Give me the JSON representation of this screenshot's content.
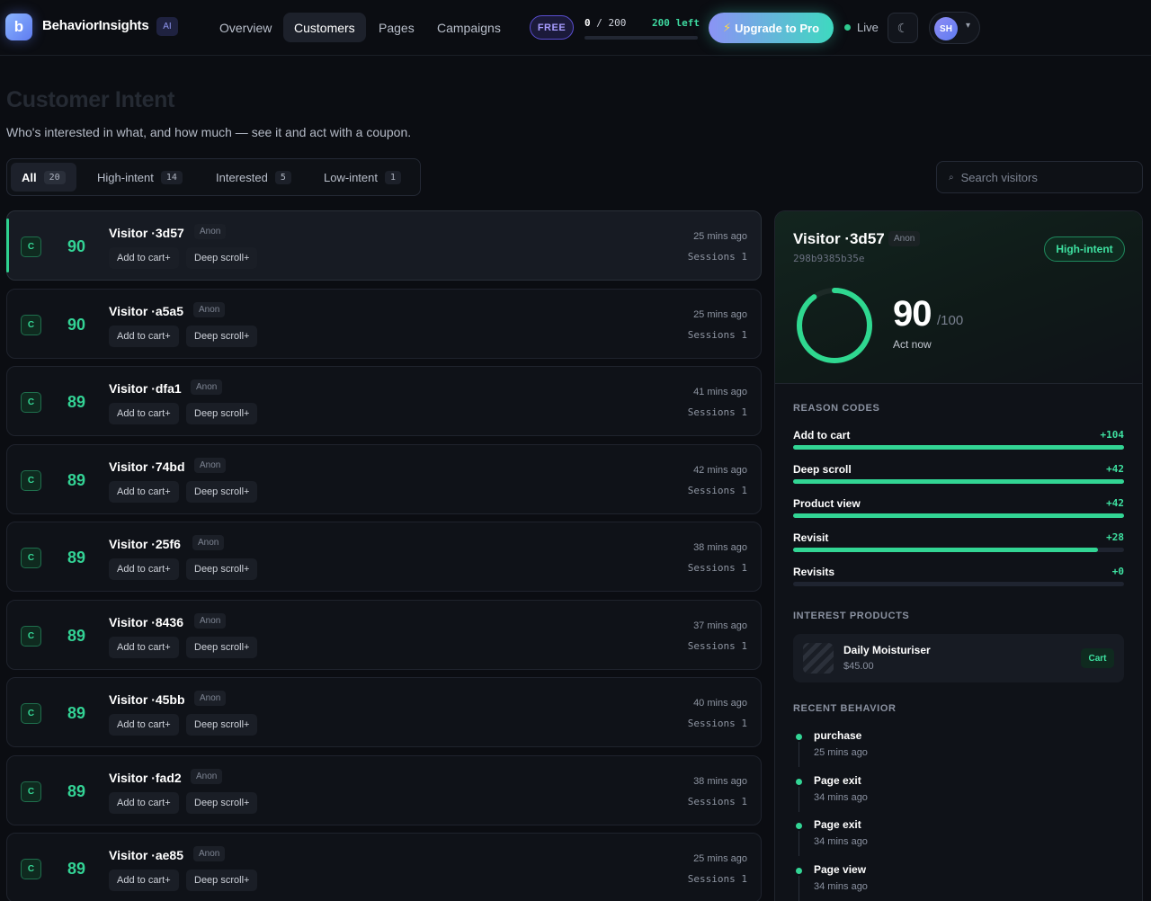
{
  "app": {
    "logo_letter": "b",
    "name": "BehaviorInsights",
    "ai_badge": "AI"
  },
  "nav": [
    {
      "label": "Overview",
      "active": false
    },
    {
      "label": "Customers",
      "active": true
    },
    {
      "label": "Pages",
      "active": false
    },
    {
      "label": "Campaigns",
      "active": false
    }
  ],
  "plan": {
    "badge": "FREE",
    "used": "0",
    "total": "/ 200",
    "left": "200 left",
    "used_fraction": 0
  },
  "upgrade": {
    "icon": "⚡",
    "label": "Upgrade to Pro"
  },
  "status": {
    "live": "Live"
  },
  "theme": {
    "icon": "☾"
  },
  "account": {
    "initials": "SH",
    "caret": "▾"
  },
  "page": {
    "title": "Customer Intent",
    "subtitle": "Who's interested in what, and how much — see it and act with a coupon."
  },
  "filters": [
    {
      "label": "All",
      "count": "20",
      "active": true
    },
    {
      "label": "High-intent",
      "count": "14",
      "active": false
    },
    {
      "label": "Interested",
      "count": "5",
      "active": false
    },
    {
      "label": "Low-intent",
      "count": "1",
      "active": false
    }
  ],
  "search": {
    "placeholder": "Search visitors",
    "icon": "⌕"
  },
  "visitors": [
    {
      "grade": "C",
      "score": "90",
      "name": "Visitor ·3d57",
      "anon": "Anon",
      "tags": [
        "Add to cart+",
        "Deep scroll+"
      ],
      "time": "25 mins ago",
      "sessions": "Sessions 1",
      "selected": true
    },
    {
      "grade": "C",
      "score": "90",
      "name": "Visitor ·a5a5",
      "anon": "Anon",
      "tags": [
        "Add to cart+",
        "Deep scroll+"
      ],
      "time": "25 mins ago",
      "sessions": "Sessions 1",
      "selected": false
    },
    {
      "grade": "C",
      "score": "89",
      "name": "Visitor ·dfa1",
      "anon": "Anon",
      "tags": [
        "Add to cart+",
        "Deep scroll+"
      ],
      "time": "41 mins ago",
      "sessions": "Sessions 1",
      "selected": false
    },
    {
      "grade": "C",
      "score": "89",
      "name": "Visitor ·74bd",
      "anon": "Anon",
      "tags": [
        "Add to cart+",
        "Deep scroll+"
      ],
      "time": "42 mins ago",
      "sessions": "Sessions 1",
      "selected": false
    },
    {
      "grade": "C",
      "score": "89",
      "name": "Visitor ·25f6",
      "anon": "Anon",
      "tags": [
        "Add to cart+",
        "Deep scroll+"
      ],
      "time": "38 mins ago",
      "sessions": "Sessions 1",
      "selected": false
    },
    {
      "grade": "C",
      "score": "89",
      "name": "Visitor ·8436",
      "anon": "Anon",
      "tags": [
        "Add to cart+",
        "Deep scroll+"
      ],
      "time": "37 mins ago",
      "sessions": "Sessions 1",
      "selected": false
    },
    {
      "grade": "C",
      "score": "89",
      "name": "Visitor ·45bb",
      "anon": "Anon",
      "tags": [
        "Add to cart+",
        "Deep scroll+"
      ],
      "time": "40 mins ago",
      "sessions": "Sessions 1",
      "selected": false
    },
    {
      "grade": "C",
      "score": "89",
      "name": "Visitor ·fad2",
      "anon": "Anon",
      "tags": [
        "Add to cart+",
        "Deep scroll+"
      ],
      "time": "38 mins ago",
      "sessions": "Sessions 1",
      "selected": false
    },
    {
      "grade": "C",
      "score": "89",
      "name": "Visitor ·ae85",
      "anon": "Anon",
      "tags": [
        "Add to cart+",
        "Deep scroll+"
      ],
      "time": "25 mins ago",
      "sessions": "Sessions 1",
      "selected": false
    }
  ],
  "detail": {
    "name": "Visitor ·3d57",
    "anon": "Anon",
    "id": "298b9385b35e",
    "intent": "High-intent",
    "score": "90",
    "score_max": "/100",
    "score_fraction": 0.9,
    "note": "Act now",
    "reason_title": "REASON CODES",
    "reasons": [
      {
        "name": "Add to cart",
        "value": "+104",
        "fill": 1.0
      },
      {
        "name": "Deep scroll",
        "value": "+42",
        "fill": 1.0
      },
      {
        "name": "Product view",
        "value": "+42",
        "fill": 1.0
      },
      {
        "name": "Revisit",
        "value": "+28",
        "fill": 0.92
      },
      {
        "name": "Revisits",
        "value": "+0",
        "fill": 0
      }
    ],
    "products_title": "INTEREST PRODUCTS",
    "product": {
      "name": "Daily Moisturiser",
      "price": "$45.00",
      "badge": "Cart"
    },
    "behavior_title": "RECENT BEHAVIOR",
    "behavior": [
      {
        "event": "purchase",
        "time": "25 mins ago"
      },
      {
        "event": "Page exit",
        "time": "34 mins ago"
      },
      {
        "event": "Page exit",
        "time": "34 mins ago"
      },
      {
        "event": "Page view",
        "time": "34 mins ago"
      }
    ]
  },
  "colors": {
    "accent": "#33d595",
    "brand": "#5f7cf0",
    "background": "#0b0d12"
  }
}
